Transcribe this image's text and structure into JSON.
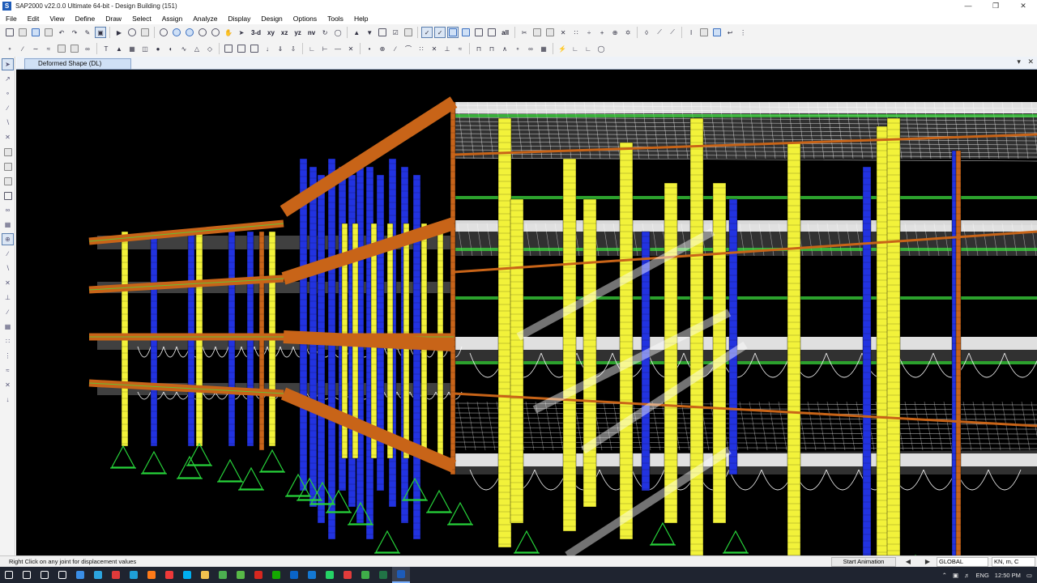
{
  "window": {
    "title": "SAP2000 v22.0.0 Ultimate 64-bit - Design Building (151)",
    "icon_letter": "S",
    "controls": [
      "minimize-icon",
      "restore-icon",
      "close-icon"
    ]
  },
  "menu": [
    "File",
    "Edit",
    "View",
    "Define",
    "Draw",
    "Select",
    "Assign",
    "Analyze",
    "Display",
    "Design",
    "Options",
    "Tools",
    "Help"
  ],
  "toolbar": {
    "view_labels": {
      "three_d": "3-d",
      "xy": "xy",
      "xz": "xz",
      "yz": "yz",
      "nv": "nv"
    },
    "all_label": "all",
    "row1_icons": [
      "new-model-icon",
      "open-icon",
      "save-icon",
      "print-icon",
      "undo-icon",
      "redo-icon",
      "edit-icon",
      "lock-icon",
      "run-analysis-icon",
      "run-icon",
      "zoom-window-icon",
      "zoom-in-icon",
      "zoom-out-icon",
      "zoom-fit-icon",
      "zoom-prev-icon",
      "pan-icon",
      "pointer-icon"
    ],
    "row2_icons": [
      "joint-icon",
      "frame-icon",
      "cable-icon",
      "tendon-icon",
      "area-icon",
      "solid-icon",
      "link-icon",
      "section-icon",
      "grid-icon",
      "assign-icon"
    ]
  },
  "document_tab": {
    "label": "Deformed Shape (DL)"
  },
  "status": {
    "message": "Right Click on any joint for displacement values",
    "animation_button": "Start Animation",
    "coordinate_system": "GLOBAL",
    "units": "KN, m, C"
  },
  "taskbar": {
    "apps": [
      {
        "name": "windows-start-icon",
        "color": "#ffffff"
      },
      {
        "name": "search-icon",
        "color": "#ffffff"
      },
      {
        "name": "cortana-icon",
        "color": "#ffffff"
      },
      {
        "name": "task-view-icon",
        "color": "#ffffff"
      },
      {
        "name": "store-icon",
        "color": "#3a8ee6"
      },
      {
        "name": "telegram-icon",
        "color": "#2ca5e0"
      },
      {
        "name": "pdf-reader-icon",
        "color": "#e03a3a"
      },
      {
        "name": "edge-icon",
        "color": "#1fa0d8"
      },
      {
        "name": "firefox-icon",
        "color": "#ff7a18"
      },
      {
        "name": "vivaldi-icon",
        "color": "#ef3939"
      },
      {
        "name": "skype-icon",
        "color": "#00aff0"
      },
      {
        "name": "explorer-icon",
        "color": "#f2c14e"
      },
      {
        "name": "chrome-icon",
        "color": "#4caf50"
      },
      {
        "name": "greenshot-icon",
        "color": "#58b947"
      },
      {
        "name": "acrobat-icon",
        "color": "#d7271f"
      },
      {
        "name": "upwork-icon",
        "color": "#14a800"
      },
      {
        "name": "outlook-icon",
        "color": "#0a64c8"
      },
      {
        "name": "skype-business-icon",
        "color": "#1478d4"
      },
      {
        "name": "whatsapp-icon",
        "color": "#25d366"
      },
      {
        "name": "recorder-icon",
        "color": "#e23b3b"
      },
      {
        "name": "camtasia-icon",
        "color": "#3fae49"
      },
      {
        "name": "excel-icon",
        "color": "#217346"
      },
      {
        "name": "sap2000-icon",
        "color": "#1d5bb8"
      }
    ],
    "language": "ENG",
    "time": "12:50 PM"
  },
  "colors": {
    "viewport_bg": "#000000",
    "column_yellow": "#f2f23a",
    "column_blue": "#2233e0",
    "column_orange": "#c8641a",
    "beam_orange": "#c86418",
    "slab_green": "#3fe640",
    "support_green": "#27d43a",
    "mesh_white": "#ffffff"
  }
}
